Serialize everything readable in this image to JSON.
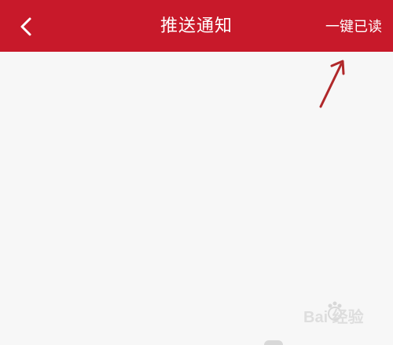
{
  "header": {
    "back_icon": "chevron-left-icon",
    "title": "推送通知",
    "action_label": "一键已读",
    "background_color": "#c8192a",
    "text_color": "#ffffff"
  },
  "content": {
    "background_color": "#f7f7f7"
  },
  "annotation": {
    "type": "arrow",
    "color": "#b0282a"
  },
  "watermark": {
    "text": "Bai  经验"
  }
}
